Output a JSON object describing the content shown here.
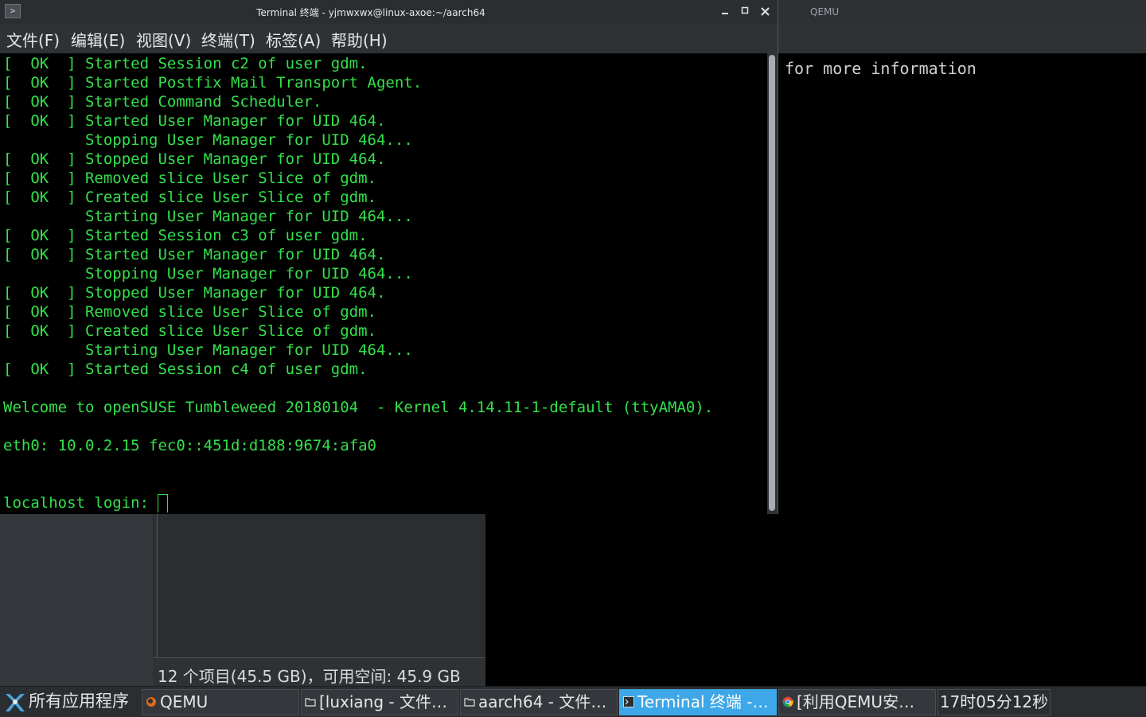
{
  "qemu": {
    "title": "QEMU",
    "console_text": "for more information"
  },
  "file_manager": {
    "status": "12 个项目(45.5 GB)，可用空间: 45.9 GB"
  },
  "terminal": {
    "title": "Terminal 终端 - yjmwxwx@linux-axoe:~/aarch64",
    "app_icon": ">",
    "menu": {
      "file": "文件(F)",
      "edit": "编辑(E)",
      "view": "视图(V)",
      "terminal": "终端(T)",
      "tabs": "标签(A)",
      "help": "帮助(H)"
    },
    "lines": [
      "[  OK  ] Started Session c2 of user gdm.",
      "[  OK  ] Started Postfix Mail Transport Agent.",
      "[  OK  ] Started Command Scheduler.",
      "[  OK  ] Started User Manager for UID 464.",
      "         Stopping User Manager for UID 464...",
      "[  OK  ] Stopped User Manager for UID 464.",
      "[  OK  ] Removed slice User Slice of gdm.",
      "[  OK  ] Created slice User Slice of gdm.",
      "         Starting User Manager for UID 464...",
      "[  OK  ] Started Session c3 of user gdm.",
      "[  OK  ] Started User Manager for UID 464.",
      "         Stopping User Manager for UID 464...",
      "[  OK  ] Stopped User Manager for UID 464.",
      "[  OK  ] Removed slice User Slice of gdm.",
      "[  OK  ] Created slice User Slice of gdm.",
      "         Starting User Manager for UID 464...",
      "[  OK  ] Started Session c4 of user gdm.",
      "",
      "Welcome to openSUSE Tumbleweed 20180104  - Kernel 4.14.11-1-default (ttyAMA0).",
      "",
      "eth0: 10.0.2.15 fec0::451d:d188:9674:afa0",
      "",
      ""
    ],
    "prompt": "localhost login: ",
    "colors": {
      "text": "#33e04a",
      "background": "#000000"
    }
  },
  "taskbar": {
    "start_label": "所有应用程序",
    "tasks": [
      {
        "label": "QEMU",
        "icon": "qemu-icon"
      },
      {
        "label": "[luxiang - 文件…",
        "icon": "folder-icon"
      },
      {
        "label": "aarch64 - 文件…",
        "icon": "folder-icon"
      },
      {
        "label": "Terminal 终端 -…",
        "icon": "terminal-icon",
        "active": true
      },
      {
        "label": "[利用QEMU安…",
        "icon": "browser-icon"
      }
    ],
    "clock": "17时05分12秒",
    "accent": "#3da7e8"
  }
}
